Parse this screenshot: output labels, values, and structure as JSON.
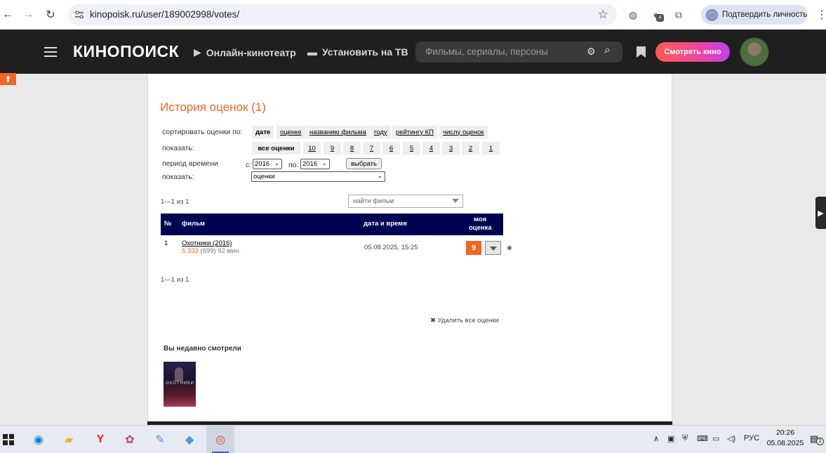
{
  "browser": {
    "url": "kinopoisk.ru/user/189002998/votes/",
    "verify_label": "Подтвердить личность",
    "ext_badge": "4"
  },
  "site": {
    "logo": "КИНОПОИСК",
    "nav_online": "Онлайн-кинотеатр",
    "nav_tv": "Установить на ТВ",
    "search_placeholder": "Фильмы, сериалы, персоны",
    "watch_label": "Смотреть кино"
  },
  "page": {
    "title": "История оценок (1)",
    "sort_label": "сортировать оценки по:",
    "sort_options": [
      "дате",
      "оценке",
      "названию фильма",
      "году",
      "рейтингу КП",
      "числу оценок"
    ],
    "show_label": "показать:",
    "show_options": [
      "все оценки",
      "10",
      "9",
      "8",
      "7",
      "6",
      "5",
      "4",
      "3",
      "2",
      "1"
    ],
    "period_label": "период времени",
    "from_label": "с:",
    "from_value": "2016",
    "to_label": "по:",
    "to_value": "2016",
    "select_button": "выбрать",
    "show2_label": "показать:",
    "show2_value": "оценки",
    "pager_top": "1—1 из 1",
    "find_film_placeholder": "найти фильм",
    "pager_bottom": "1—1 из 1",
    "delete_all": "Удалить все оценки",
    "recent_heading": "Вы недавно смотрели",
    "recent_poster_title": "ОХОТНИКИ"
  },
  "table": {
    "headers": {
      "num": "№",
      "film": "фильм",
      "datetime": "дата и время",
      "my_vote_1": "моя",
      "my_vote_2": "оценка"
    },
    "rows": [
      {
        "num": "1",
        "film": "Охотники (2016)",
        "rating": "5.333",
        "votes": "(699)",
        "duration": "92 мин.",
        "datetime": "05.08.2025, 15:25",
        "my_vote": "9"
      }
    ]
  },
  "taskbar": {
    "lang": "РУС",
    "time": "20:26",
    "date": "05.08.2025",
    "notif_count": "2"
  },
  "colors": {
    "accent": "#f26522",
    "table_header": "#000052",
    "site_header": "#1f1f1f"
  }
}
